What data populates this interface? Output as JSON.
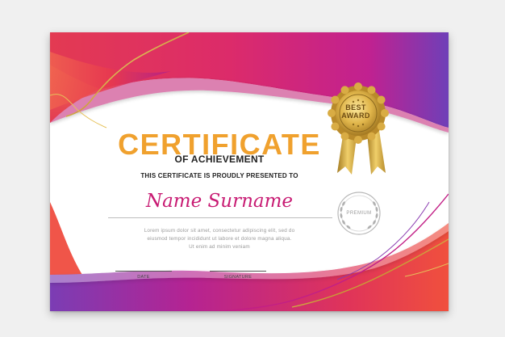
{
  "certificate": {
    "title": "CERTIFICATE",
    "subtitle": "OF ACHIEVEMENT",
    "presented_text": "THIS CERTIFICATE IS PROUDLY PRESENTED TO",
    "recipient_name": "Name Surname",
    "body_text": [
      "Lorem ipsum dolor sit amet, consectetur adipiscing elit, sed do",
      "eiusmod tempor incididunt ut labore et dolore magna aliqua.",
      "Ut enim ad minim veniam"
    ],
    "date_label": "DATE",
    "signature_label": "SIGNATURE"
  },
  "award_badge": {
    "line1": "BEST",
    "line2": "AWARD"
  },
  "premium_seal": {
    "label": "PREMIUM"
  },
  "colors": {
    "title_gold": "#f0a12e",
    "name_pink": "#c81b73",
    "wave_red": "#e8394e",
    "wave_magenta": "#d01e7a",
    "wave_purple": "#7a3fb6",
    "gold_ribbon": "#c9a23a"
  }
}
